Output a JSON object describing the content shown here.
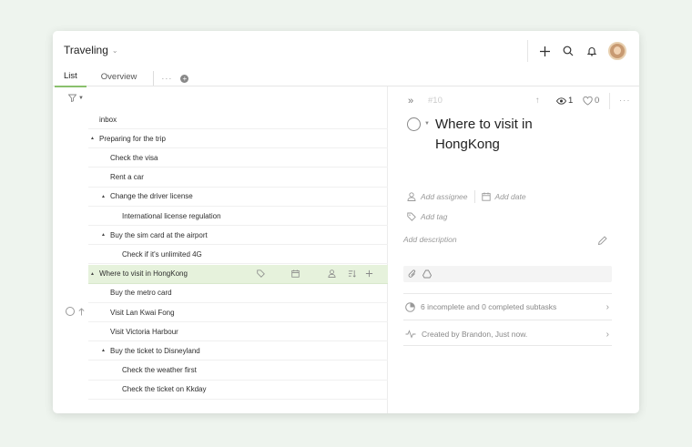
{
  "header": {
    "project_title": "Traveling",
    "tabs": [
      "List",
      "Overview"
    ],
    "more_label": "···"
  },
  "tasks": [
    {
      "label": "inbox",
      "level": 0,
      "collapsible": false
    },
    {
      "label": "Preparing for the trip",
      "level": 0,
      "collapsible": true
    },
    {
      "label": "Check the visa",
      "level": 1,
      "collapsible": false
    },
    {
      "label": "Rent a car",
      "level": 1,
      "collapsible": false
    },
    {
      "label": "Change the driver license",
      "level": 1,
      "collapsible": true
    },
    {
      "label": "International license regulation",
      "level": 2,
      "collapsible": false
    },
    {
      "label": "Buy the sim card at the airport",
      "level": 1,
      "collapsible": true
    },
    {
      "label": "Check if it's unlimited 4G",
      "level": 2,
      "collapsible": false
    },
    {
      "label": "Where to visit in HongKong",
      "level": 0,
      "collapsible": true,
      "selected": true
    },
    {
      "label": "Buy the metro card",
      "level": 1,
      "collapsible": false
    },
    {
      "label": "Visit Lan Kwai Fong",
      "level": 1,
      "collapsible": false
    },
    {
      "label": "Visit Victoria Harbour",
      "level": 1,
      "collapsible": false
    },
    {
      "label": "Buy the ticket to Disneyland",
      "level": 1,
      "collapsible": true
    },
    {
      "label": "Check the weather first",
      "level": 2,
      "collapsible": false
    },
    {
      "label": "Check the ticket on Kkday",
      "level": 2,
      "collapsible": false
    }
  ],
  "detail": {
    "task_number": "#10",
    "views_count": "1",
    "likes_count": "0",
    "title": "Where to visit in HongKong",
    "add_assignee": "Add assignee",
    "add_date": "Add date",
    "add_tag": "Add tag",
    "add_description": "Add description",
    "subtasks_text": "6 incomplete and 0 completed subtasks",
    "created_text": "Created by Brandon, Just now."
  },
  "colors": {
    "accent": "#8ac06d",
    "selected_row": "#e6f2dc",
    "background": "#eef4ee"
  }
}
